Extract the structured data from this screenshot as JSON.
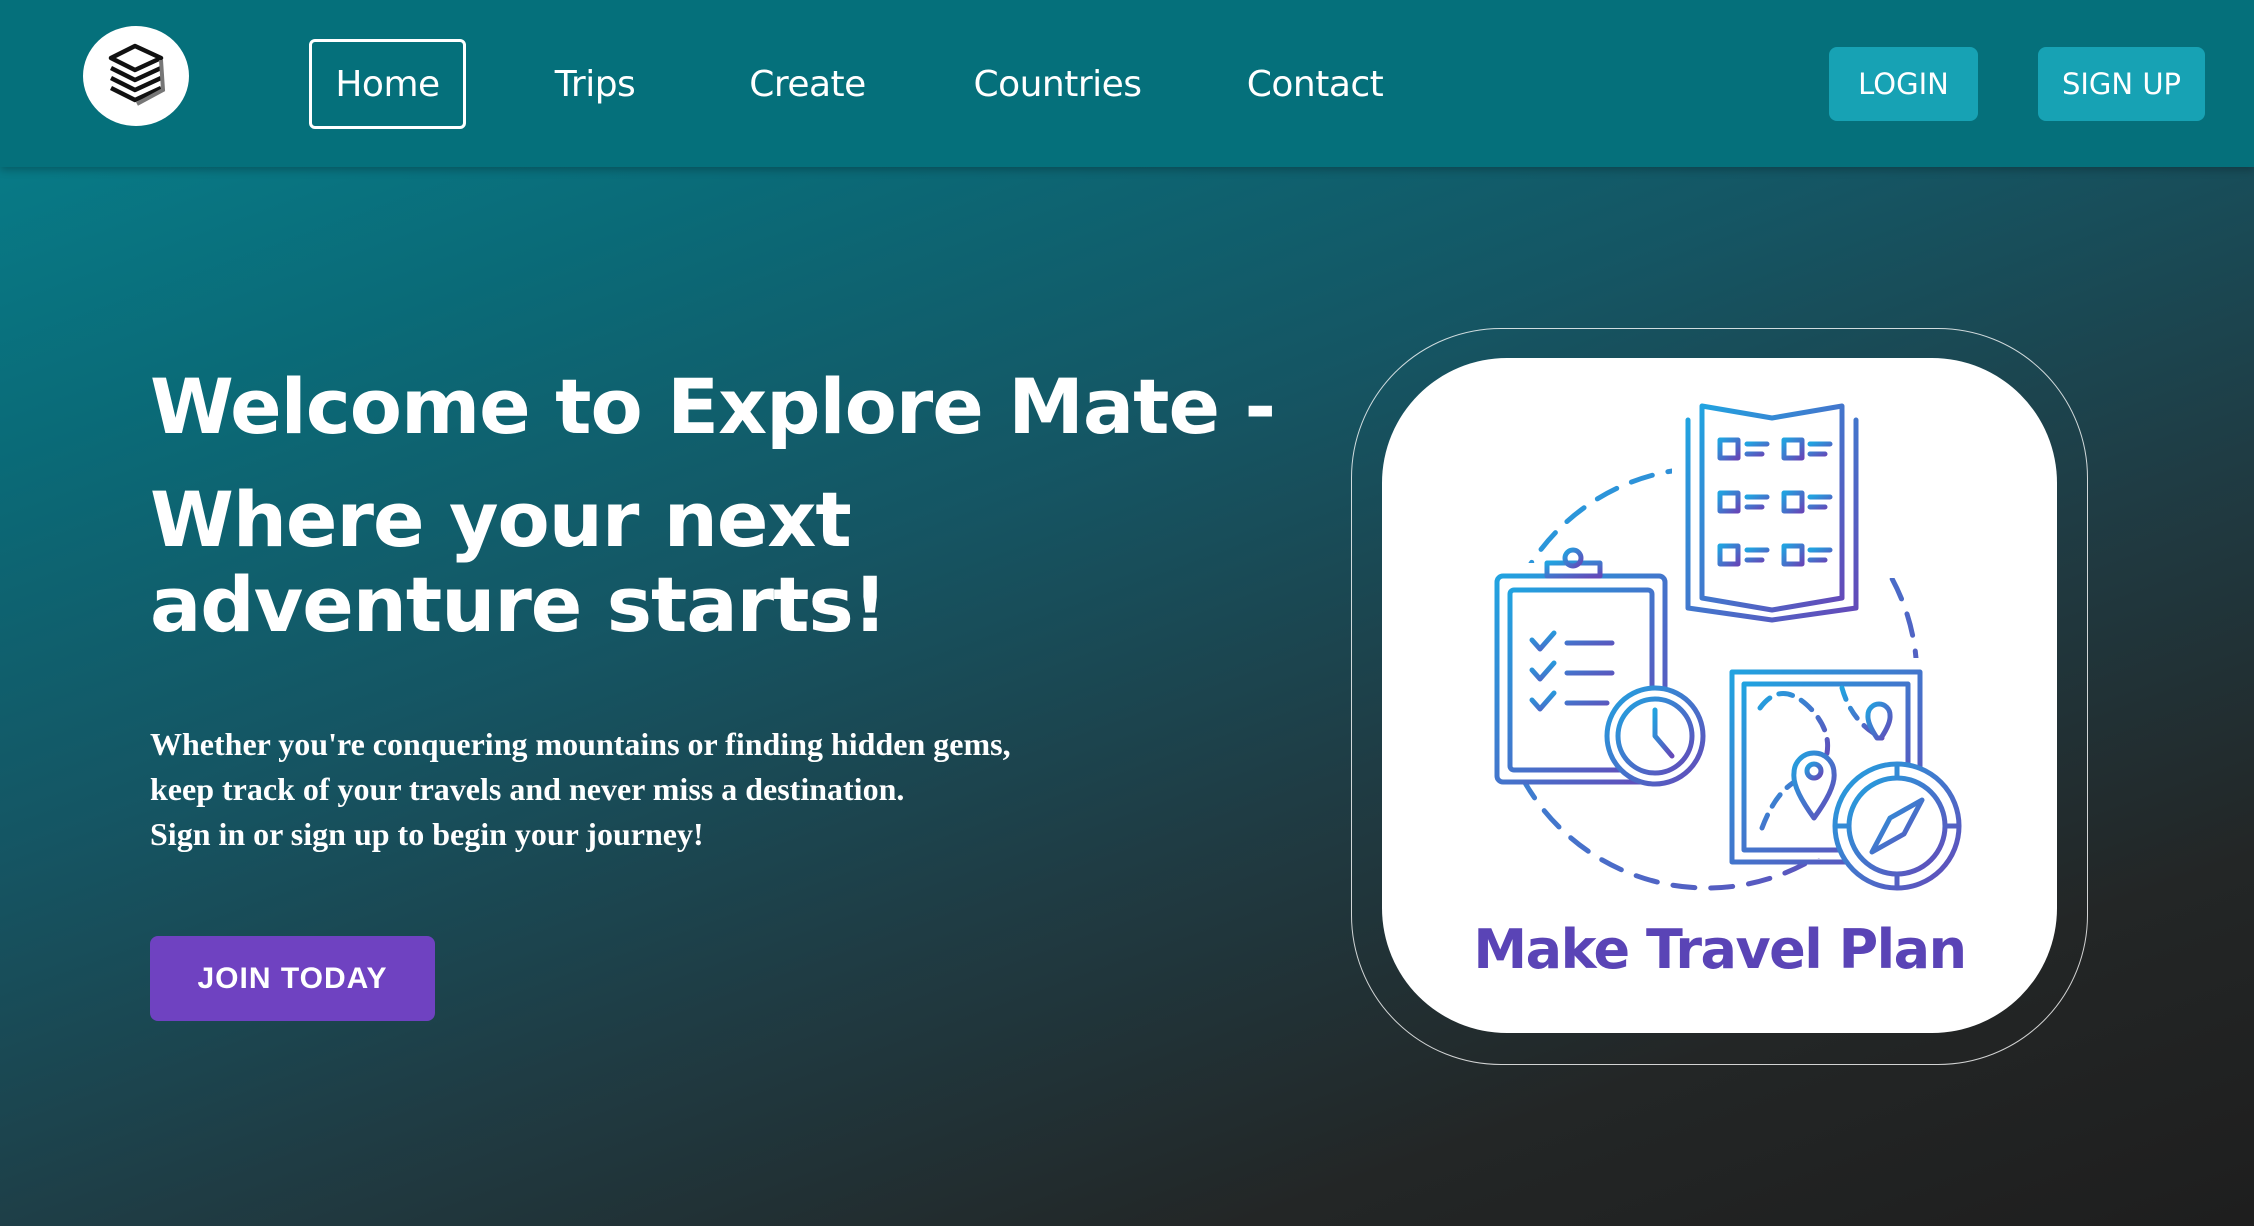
{
  "nav": {
    "logo_icon": "layers-logo-icon",
    "links": [
      {
        "label": "Home",
        "active": true
      },
      {
        "label": "Trips",
        "active": false
      },
      {
        "label": "Create",
        "active": false
      },
      {
        "label": "Countries",
        "active": false
      },
      {
        "label": "Contact",
        "active": false
      }
    ],
    "login_label": "LOGIN",
    "signup_label": "SIGN UP"
  },
  "hero": {
    "title_line1": "Welcome to Explore Mate -",
    "title_line2": "Where your next",
    "title_line3": "adventure starts!",
    "desc_line1": "Whether you're conquering mountains or finding hidden gems,",
    "desc_line2": "keep track of your travels and never miss a destination.",
    "desc_line3": "Sign in or sign up to begin your journey!",
    "cta_label": "JOIN TODAY"
  },
  "illustration": {
    "caption": "Make Travel Plan",
    "icons": [
      "brochure-icon",
      "checklist-clipboard-icon",
      "clock-icon",
      "map-icon",
      "location-pin-icon",
      "compass-icon"
    ]
  },
  "colors": {
    "navbar": "#05707b",
    "auth_button": "#17a2b4",
    "cta_button": "#6f42c1",
    "caption": "#5a44b6",
    "icon_blue": "#1d95dc",
    "icon_purple": "#6548b8"
  }
}
